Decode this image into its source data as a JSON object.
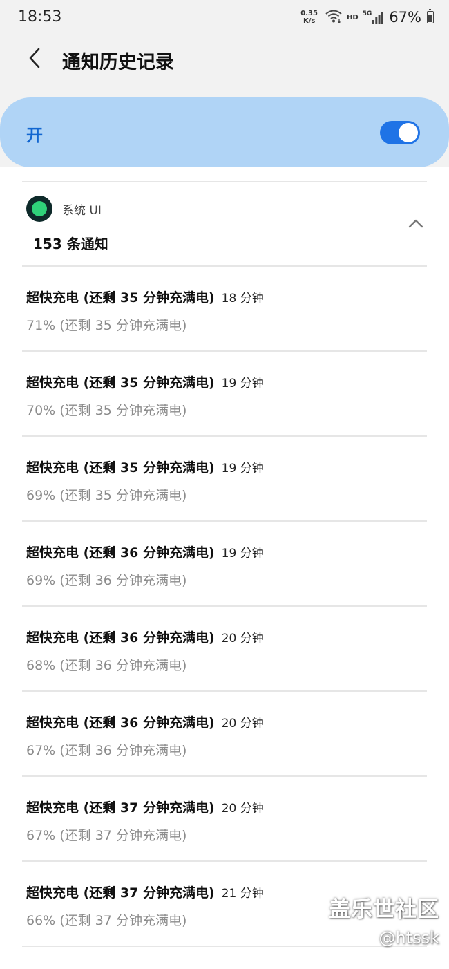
{
  "status_bar": {
    "time": "18:53",
    "net_speed_value": "0.35",
    "net_speed_unit": "K/s",
    "hd": "HD",
    "network": "5G",
    "battery": "67%"
  },
  "app_bar": {
    "title": "通知历史记录"
  },
  "master_switch": {
    "label": "开",
    "on": true,
    "accent": "#1f73e6"
  },
  "group": {
    "app_name": "系统 UI",
    "count_label": "153 条通知"
  },
  "notifications": [
    {
      "title": "超快充电 (还剩 35 分钟充满电)",
      "time": "18 分钟",
      "text": "71% (还剩 35 分钟充满电)"
    },
    {
      "title": "超快充电 (还剩 35 分钟充满电)",
      "time": "19 分钟",
      "text": "70% (还剩 35 分钟充满电)"
    },
    {
      "title": "超快充电 (还剩 35 分钟充满电)",
      "time": "19 分钟",
      "text": "69% (还剩 35 分钟充满电)"
    },
    {
      "title": "超快充电 (还剩 36 分钟充满电)",
      "time": "19 分钟",
      "text": "69% (还剩 36 分钟充满电)"
    },
    {
      "title": "超快充电 (还剩 36 分钟充满电)",
      "time": "20 分钟",
      "text": "68% (还剩 36 分钟充满电)"
    },
    {
      "title": "超快充电 (还剩 36 分钟充满电)",
      "time": "20 分钟",
      "text": "67% (还剩 36 分钟充满电)"
    },
    {
      "title": "超快充电 (还剩 37 分钟充满电)",
      "time": "20 分钟",
      "text": "67% (还剩 37 分钟充满电)"
    },
    {
      "title": "超快充电 (还剩 37 分钟充满电)",
      "time": "21 分钟",
      "text": "66% (还剩 37 分钟充满电)"
    }
  ],
  "watermark": {
    "line1": "盖乐世社区",
    "line2": "@htssk"
  }
}
